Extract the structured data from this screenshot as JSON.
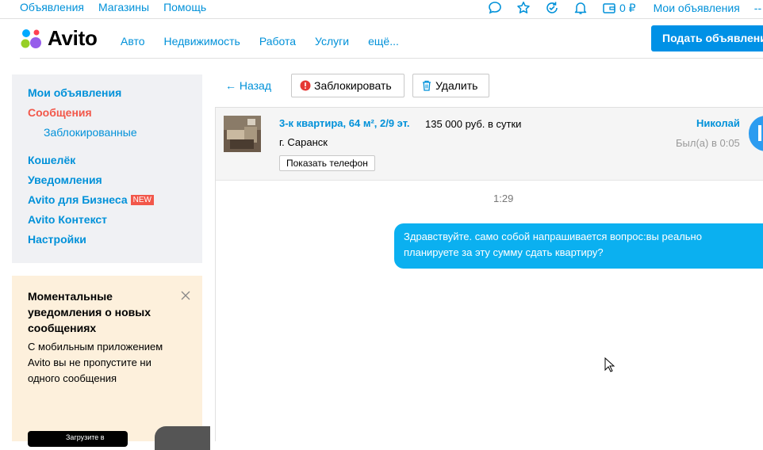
{
  "topbar": {
    "links": [
      "Объявления",
      "Магазины",
      "Помощь"
    ],
    "icons": [
      "chat-icon",
      "star-icon",
      "refresh-icon",
      "bell-icon",
      "wallet-icon"
    ],
    "wallet": "0 ₽",
    "my_ads": "Мои объявления",
    "trailing": "--"
  },
  "header": {
    "logo_text": "Avito",
    "nav": [
      "Авто",
      "Недвижимость",
      "Работа",
      "Услуги",
      "ещё..."
    ],
    "post_button": "Подать объявление"
  },
  "sidebar": {
    "items": [
      {
        "label": "Мои объявления"
      },
      {
        "label": "Сообщения",
        "active": true
      },
      {
        "label": "Заблокированные",
        "sub": true
      },
      {
        "label": "Кошелёк"
      },
      {
        "label": "Уведомления"
      },
      {
        "label": "Avito для Бизнеса",
        "badge": "NEW"
      },
      {
        "label": "Avito Контекст"
      },
      {
        "label": "Настройки"
      }
    ]
  },
  "promo": {
    "title": "Моментальные уведомления о новых сообщениях",
    "text": "С мобильным приложением Avito вы не пропустите ни одного сообщения",
    "appstore_label": "Загрузите в"
  },
  "toolbar": {
    "back": "← Назад",
    "block": "Заблокировать",
    "delete": "Удалить"
  },
  "chat": {
    "ad_title": "3-к квартира, 64 м², 2/9 эт.",
    "ad_price": "135 000 руб. в сутки",
    "ad_city": "г. Саранск",
    "show_phone": "Показать телефон",
    "user_name": "Николай",
    "user_status": "Был(а) в 0:05",
    "time": "1:29",
    "message": "Здравствуйте. само собой напрашивается вопрос:вы реально планируете за эту сумму сдать квартиру?"
  },
  "colors": {
    "link": "#0091d9",
    "active": "#f2574a",
    "primary_button": "#0091e6",
    "bubble": "#0bb0f0"
  }
}
